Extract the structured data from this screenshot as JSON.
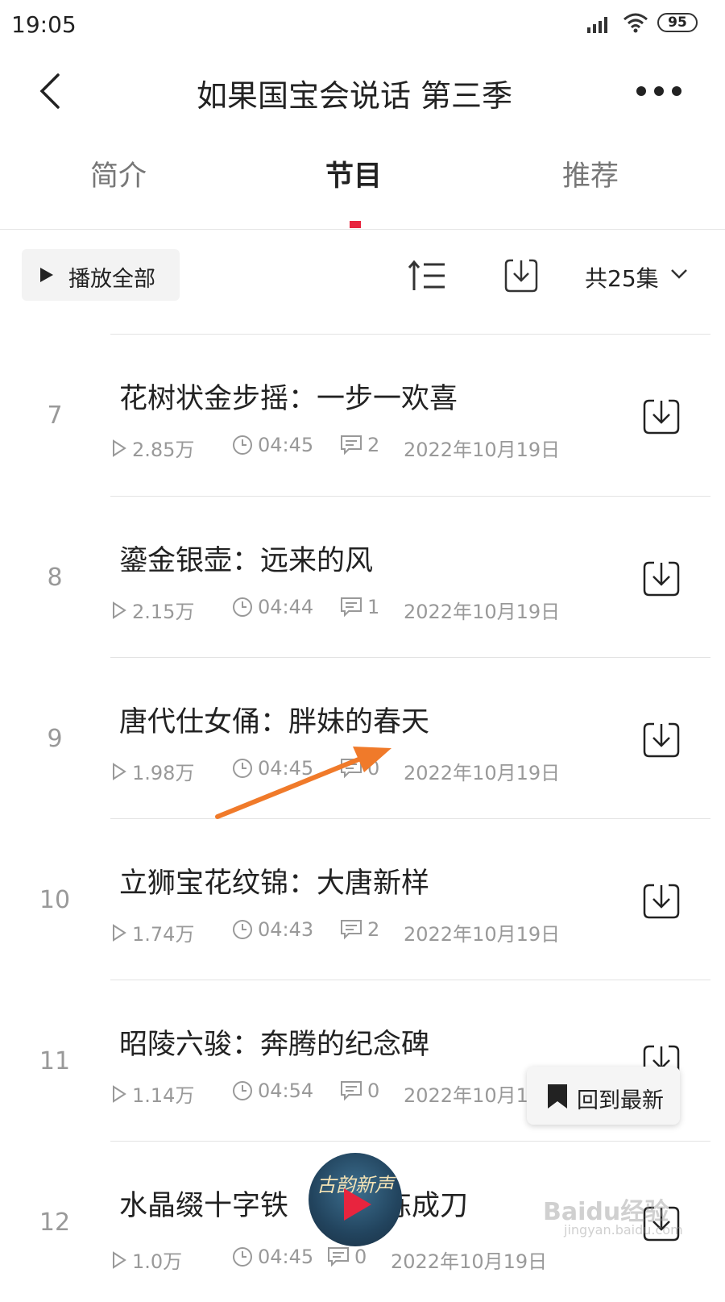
{
  "status_bar": {
    "time": "19:05",
    "battery": "95"
  },
  "header": {
    "title": "如果国宝会说话 第三季"
  },
  "tabs": [
    {
      "label": "简介",
      "active": false
    },
    {
      "label": "节目",
      "active": true
    },
    {
      "label": "推荐",
      "active": false
    }
  ],
  "toolbar": {
    "play_all_label": "播放全部",
    "count_label": "共25集"
  },
  "episodes": [
    {
      "num": "7",
      "title": "花树状金步摇：一步一欢喜",
      "plays": "2.85万",
      "duration": "04:45",
      "comments": "2",
      "date": "2022年10月19日"
    },
    {
      "num": "8",
      "title": "鎏金银壶：远来的风",
      "plays": "2.15万",
      "duration": "04:44",
      "comments": "1",
      "date": "2022年10月19日"
    },
    {
      "num": "9",
      "title": "唐代仕女俑：胖妹的春天",
      "plays": "1.98万",
      "duration": "04:45",
      "comments": "0",
      "date": "2022年10月19日"
    },
    {
      "num": "10",
      "title": "立狮宝花纹锦：大唐新样",
      "plays": "1.74万",
      "duration": "04:43",
      "comments": "2",
      "date": "2022年10月19日"
    },
    {
      "num": "11",
      "title": "昭陵六骏：奔腾的纪念碑",
      "plays": "1.14万",
      "duration": "04:54",
      "comments": "0",
      "date": "2022年10月19日"
    },
    {
      "num": "12",
      "title": "水晶缀十字铁",
      "title_tail": "炼成刀",
      "plays": "1.0万",
      "duration": "04:45",
      "comments": "0",
      "date": "2022年10月19日"
    }
  ],
  "floating": {
    "back_to_latest_label": "回到最新",
    "mini_player_cover_text": "古韵新声"
  },
  "watermark": {
    "text": "Baidu经验",
    "url_text": "jingyan.baidu.com"
  },
  "colors": {
    "accent": "#e8243e",
    "arrow": "#f07a2a"
  }
}
